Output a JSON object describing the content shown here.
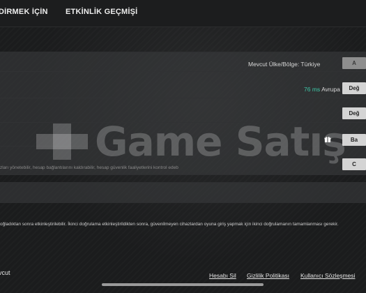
{
  "tabs": [
    "DİRMEK İÇİN TAF",
    "ETKİNLİK GEÇMİŞİ"
  ],
  "region": {
    "label": "Mevcut Ülke/Bölge: Türkiye",
    "button": "A"
  },
  "latency": {
    "ms": "76 ms",
    "server": "Avrupa",
    "button": "Değ"
  },
  "rows": [
    {
      "button": "Değ"
    },
    {
      "button": "Ba"
    },
    {
      "button": "C"
    }
  ],
  "icons": {
    "gift": "gift-icon"
  },
  "descriptions": {
    "account": "zları yönetebilir, hesap bağlantılarını kaldırabilir, hesap güvenlik faaliyetlerini kontrol edeb",
    "twofa": "oğladıktan sonra etkinleştirilebilir. İkinci doğrulama etkinleştirildikten sonra, güvenilmeyen cihazlardan oyuna giriş yapmak için ikinci doğrulamanın tamamlanması gerekir."
  },
  "section_label": "vcut",
  "watermark": "Game Satış",
  "footer": [
    "Hesabı Sil",
    "Gizlilik Politikası",
    "Kullanıcı Sözleşmesi"
  ],
  "colors": {
    "accent": "#3ec8a8",
    "background": "#1b1c1d",
    "button": "#d4d4d4"
  }
}
